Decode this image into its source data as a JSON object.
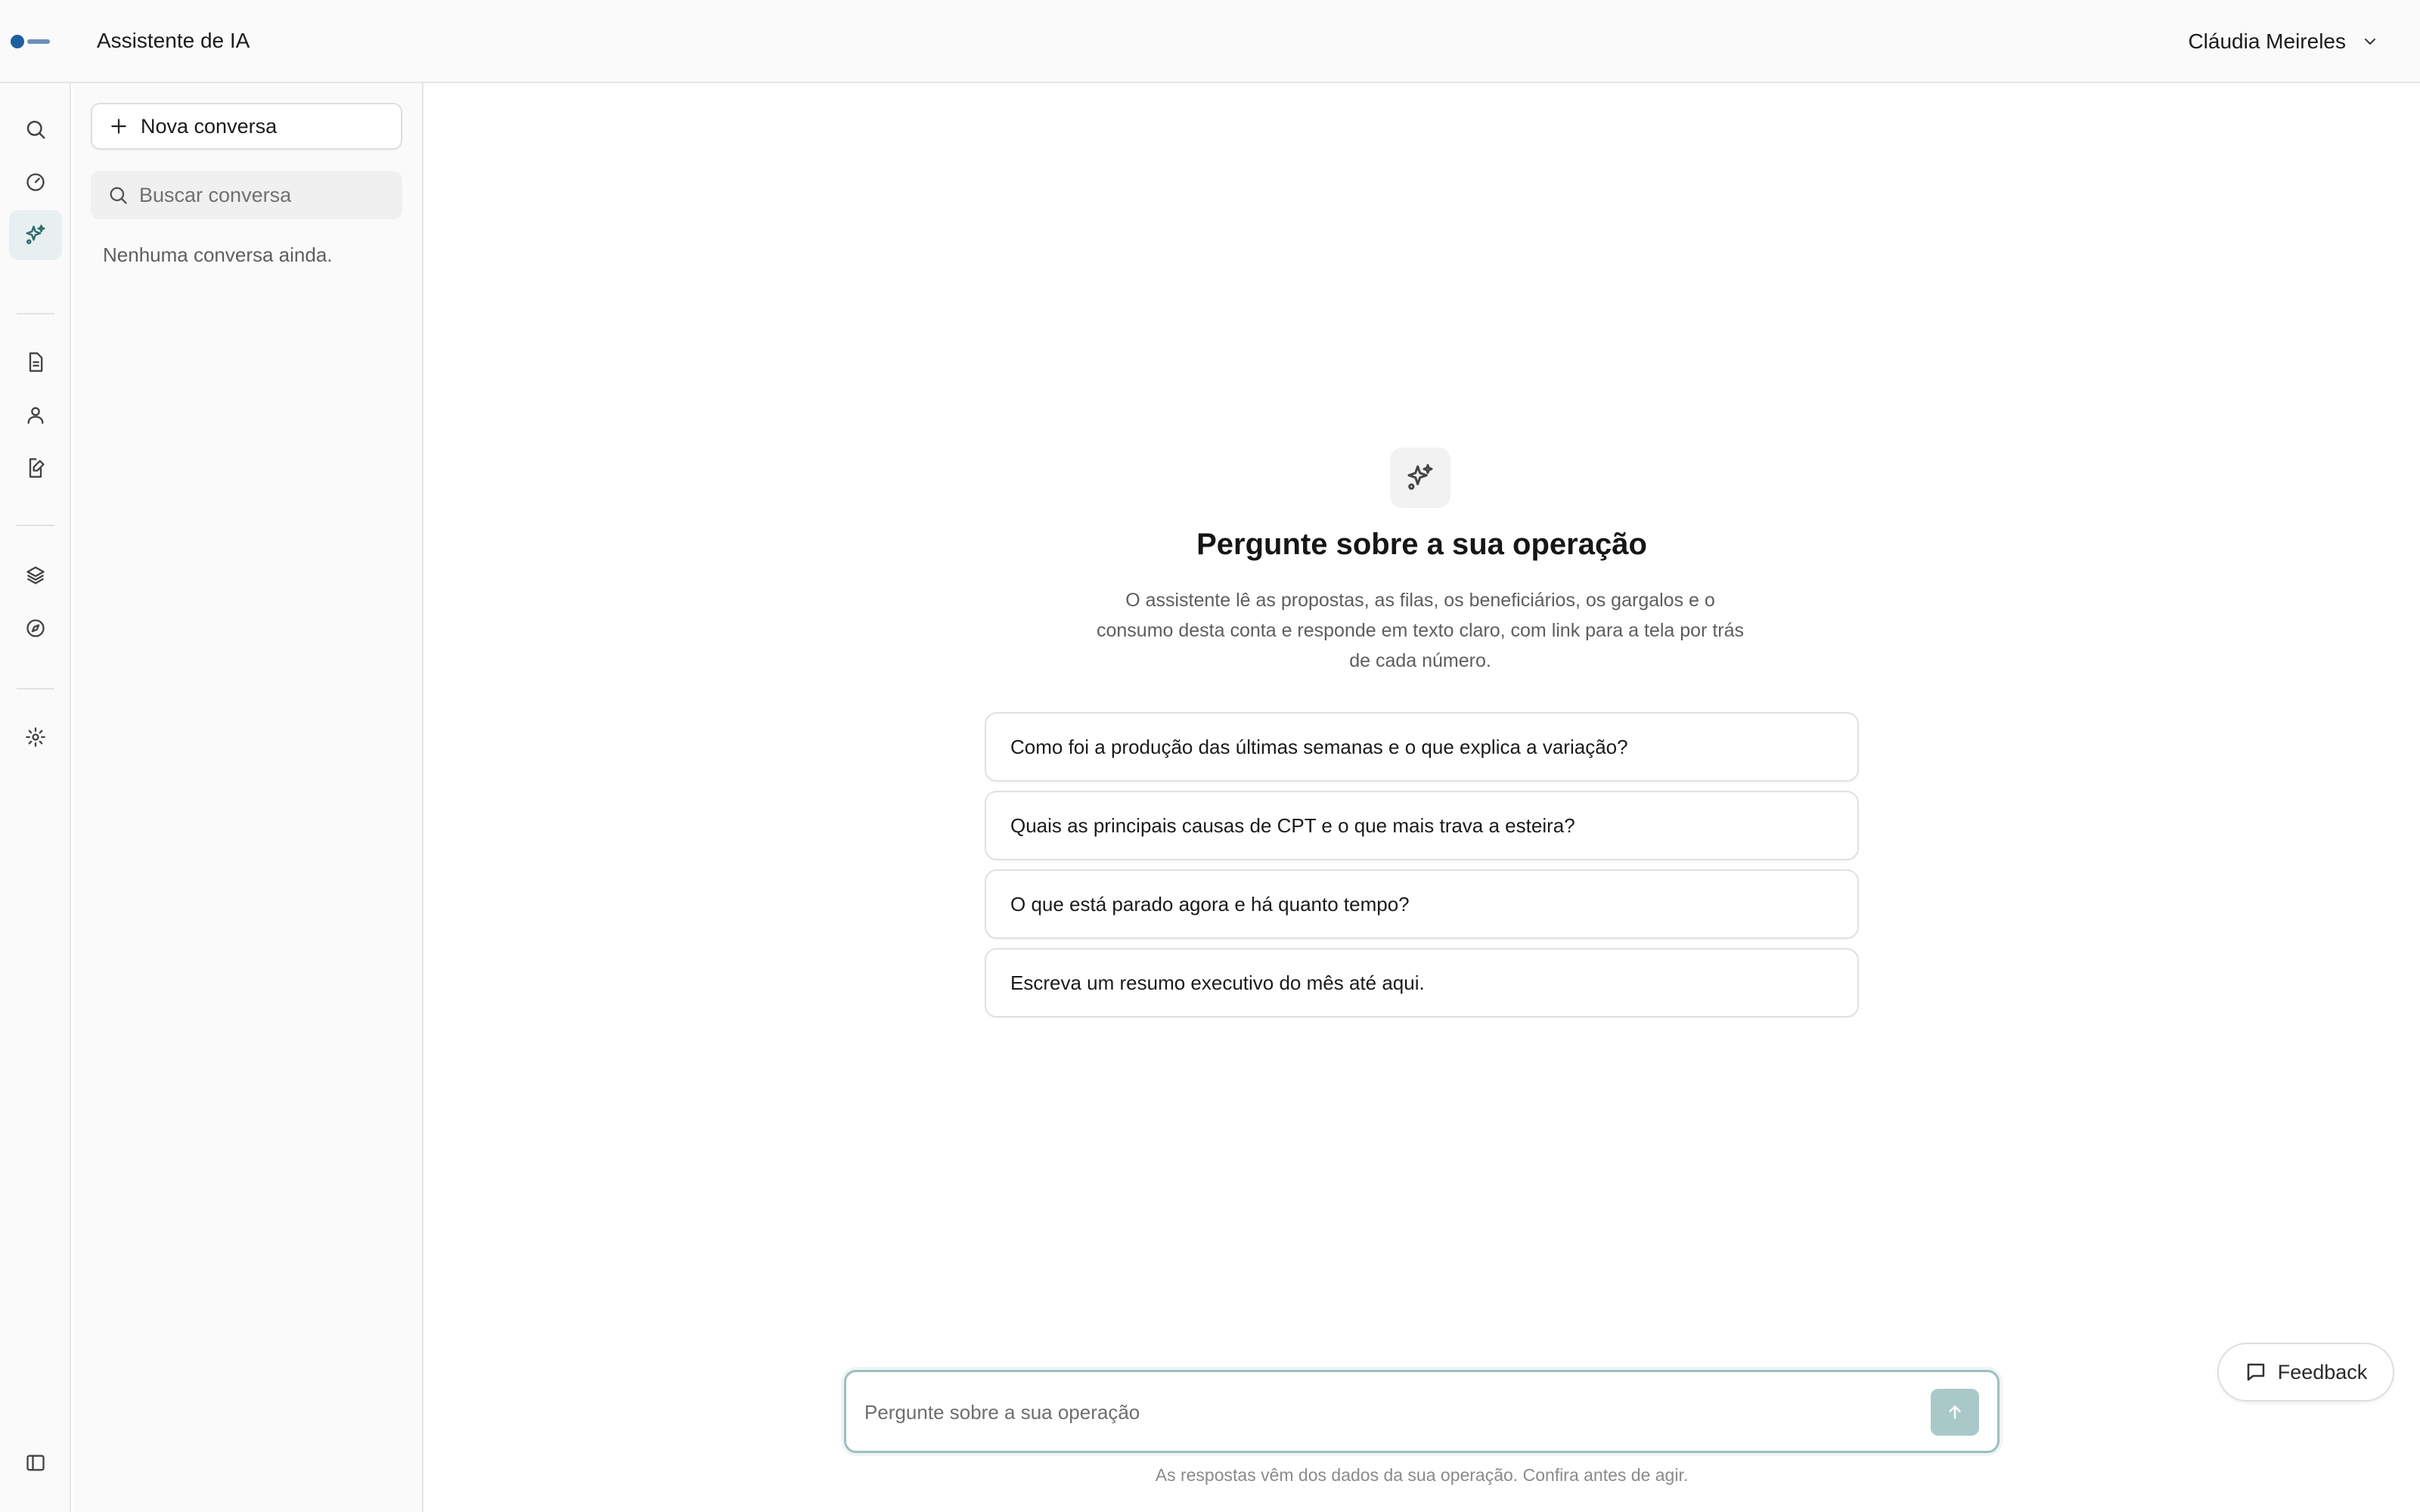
{
  "header": {
    "title": "Assistente de IA",
    "user_name": "Cláudia Meireles"
  },
  "rail": {
    "icons": [
      "search-icon",
      "gauge-icon",
      "sparkle-icon",
      "document-icon",
      "user-icon",
      "edit-document-icon",
      "layers-icon",
      "compass-icon",
      "gear-icon",
      "sidebar-toggle-icon"
    ],
    "active": "sparkle-icon"
  },
  "sidebar": {
    "new_conversation_label": "Nova conversa",
    "search_placeholder": "Buscar conversa",
    "empty_text": "Nenhuma conversa ainda."
  },
  "main": {
    "title": "Pergunte sobre a sua operação",
    "description": "O assistente lê as propostas, as filas, os beneficiários, os gargalos e o consumo desta conta e responde em texto claro, com link para a tela por trás de cada número.",
    "suggestions": [
      "Como foi a produção das últimas semanas e o que explica a variação?",
      "Quais as principais causas de CPT e o que mais trava a esteira?",
      "O que está parado agora e há quanto tempo?",
      "Escreva um resumo executivo do mês até aqui."
    ],
    "input_placeholder": "Pergunte sobre a sua operação",
    "disclaimer": "As respostas vêm dos dados da sua operação. Confira antes de agir."
  },
  "feedback": {
    "label": "Feedback"
  },
  "colors": {
    "accent": "#2f6b6b",
    "active_bg": "#e7eff0",
    "send_button": "#a9c9c9",
    "composer_border": "#9dbfbf"
  }
}
